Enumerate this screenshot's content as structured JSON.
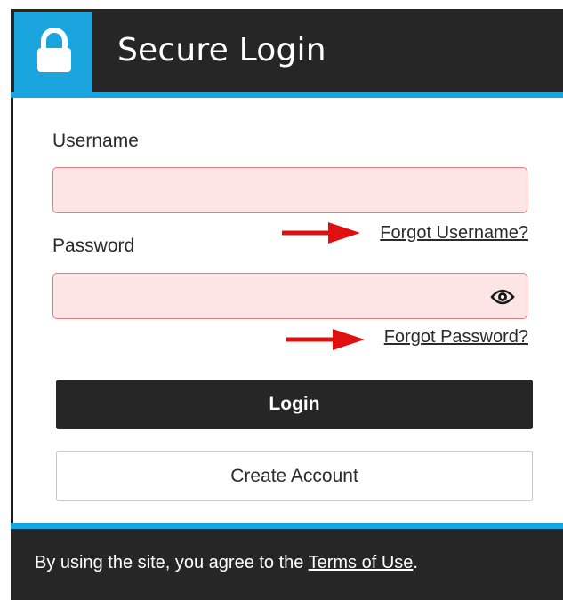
{
  "header": {
    "title": "Secure Login",
    "icon": "lock-icon"
  },
  "form": {
    "username_label": "Username",
    "username_value": "",
    "forgot_username": "Forgot Username?",
    "password_label": "Password",
    "password_value": "",
    "password_toggle_icon": "eye-icon",
    "forgot_password": "Forgot Password?",
    "login_label": "Login",
    "create_account_label": "Create Account"
  },
  "annotations": {
    "arrow_color": "#e01010",
    "arrow_icon": "right-arrow-icon"
  },
  "footer": {
    "text_before": "By using the site, you agree to the ",
    "terms_link": "Terms of Use",
    "text_after": "."
  },
  "colors": {
    "accent": "#1aa5de",
    "dark": "#262626",
    "field_bg": "#fde5e5",
    "field_border": "#e87b7b"
  }
}
